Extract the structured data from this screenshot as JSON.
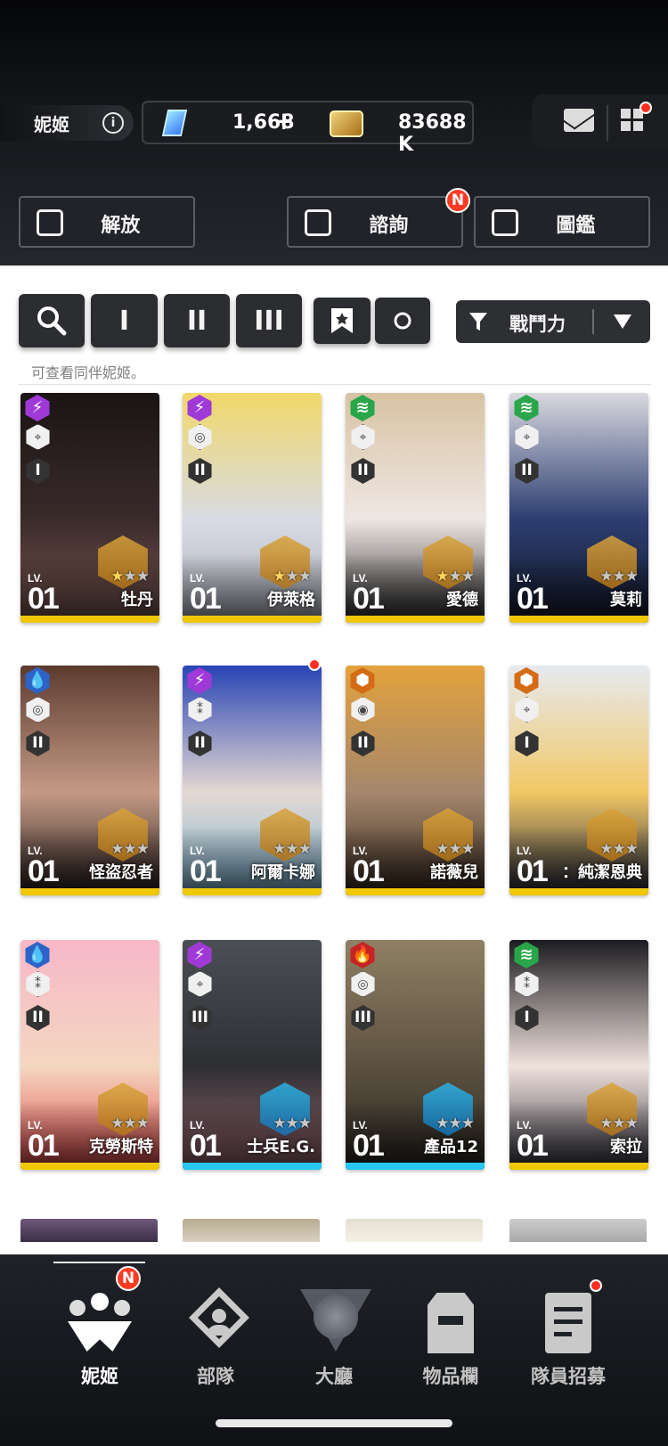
{
  "header": {
    "title": "妮姬",
    "gems": "1,668",
    "credits": "83688 K"
  },
  "actions": [
    {
      "label": "解放"
    },
    {
      "label": "諮詢",
      "badge": "N"
    },
    {
      "label": "圖鑑"
    }
  ],
  "filters": {
    "burst": [
      "I",
      "II",
      "III"
    ],
    "sort_label": "戰鬥力"
  },
  "hint": "可查看同伴妮姬。",
  "cards": [
    {
      "name": "牡丹",
      "level_label": "LV.",
      "level": "01",
      "element": "⚡",
      "element_color": "#a03ad7",
      "weapon": "⌖",
      "burst": "I",
      "stars": 1,
      "emblem": "gold",
      "art": [
        "#1a1414",
        "#3a2a2a",
        "#7e5c55"
      ]
    },
    {
      "name": "伊萊格",
      "level_label": "LV.",
      "level": "01",
      "element": "⚡",
      "element_color": "#a03ad7",
      "weapon": "◎",
      "burst": "II",
      "stars": 1,
      "emblem": "gold",
      "art": [
        "#f1d86a",
        "#d8dbe3",
        "#aeb3bd"
      ]
    },
    {
      "name": "愛德",
      "level_label": "LV.",
      "level": "01",
      "element": "≋",
      "element_color": "#2aa64a",
      "weapon": "⌖",
      "burst": "II",
      "stars": 1,
      "emblem": "gold",
      "art": [
        "#d8c3a3",
        "#efe7e3",
        "#2d2d2d"
      ]
    },
    {
      "name": "莫莉",
      "level_label": "LV.",
      "level": "01",
      "element": "≋",
      "element_color": "#2aa64a",
      "weapon": "⌖",
      "burst": "II",
      "stars": 0,
      "emblem": "gold",
      "art": [
        "#d9d9e0",
        "#2c3d70",
        "#151b2d"
      ]
    },
    {
      "name": "怪盜忍者",
      "level_label": "LV.",
      "level": "01",
      "element": "💧",
      "element_color": "#2e63c8",
      "weapon": "◎",
      "burst": "II",
      "stars": 0,
      "emblem": "gold",
      "art": [
        "#5c3b2f",
        "#c49a85",
        "#2a2020"
      ]
    },
    {
      "name": "阿爾卡娜",
      "level_label": "LV.",
      "level": "01",
      "element": "⚡",
      "element_color": "#a03ad7",
      "weapon": "⁑",
      "burst": "II",
      "stars": 0,
      "emblem": "gold",
      "art": [
        "#2844b5",
        "#e5d8d2",
        "#7fb9d8"
      ]
    },
    {
      "name": "諾薇兒",
      "level_label": "LV.",
      "level": "01",
      "element": "⬢",
      "element_color": "#d46c16",
      "weapon": "◉",
      "burst": "II",
      "stars": 0,
      "emblem": "gold",
      "art": [
        "#e3a23c",
        "#a5876c",
        "#3a2c22"
      ]
    },
    {
      "name": "：純潔恩典",
      "level_label": "LV.",
      "level": "01",
      "element": "⬢",
      "element_color": "#d46c16",
      "weapon": "⌖",
      "burst": "I",
      "stars": 0,
      "emblem": "gold",
      "art": [
        "#e6eaf0",
        "#f2c866",
        "#2a2d40"
      ]
    },
    {
      "name": "克勞斯特",
      "level_label": "LV.",
      "level": "01",
      "element": "💧",
      "element_color": "#2e63c8",
      "weapon": "⁑",
      "burst": "II",
      "stars": 0,
      "emblem": "gold",
      "art": [
        "#f7b7c8",
        "#f4d7c0",
        "#e34a4a"
      ]
    },
    {
      "name": "士兵E.G.",
      "level_label": "LV.",
      "level": "01",
      "element": "⚡",
      "element_color": "#a03ad7",
      "weapon": "⌖",
      "burst": "III",
      "stars": 0,
      "emblem": "blue",
      "art": [
        "#4b4f55",
        "#2d2f33",
        "#9a6a72"
      ]
    },
    {
      "name": "產品12",
      "level_label": "LV.",
      "level": "01",
      "element": "🔥",
      "element_color": "#c42424",
      "weapon": "◎",
      "burst": "III",
      "stars": 0,
      "emblem": "blue",
      "art": [
        "#8f8064",
        "#5c5140",
        "#2c2822"
      ]
    },
    {
      "name": "索拉",
      "level_label": "LV.",
      "level": "01",
      "element": "≋",
      "element_color": "#2aa64a",
      "weapon": "⁑",
      "burst": "I",
      "stars": 0,
      "emblem": "gold",
      "art": [
        "#1c1c20",
        "#f0e1dc",
        "#3a3a45"
      ]
    }
  ],
  "nav": [
    {
      "label": "妮姬",
      "badge": "N",
      "active": true
    },
    {
      "label": "部隊"
    },
    {
      "label": "大廳"
    },
    {
      "label": "物品欄"
    },
    {
      "label": "隊員招募"
    }
  ]
}
